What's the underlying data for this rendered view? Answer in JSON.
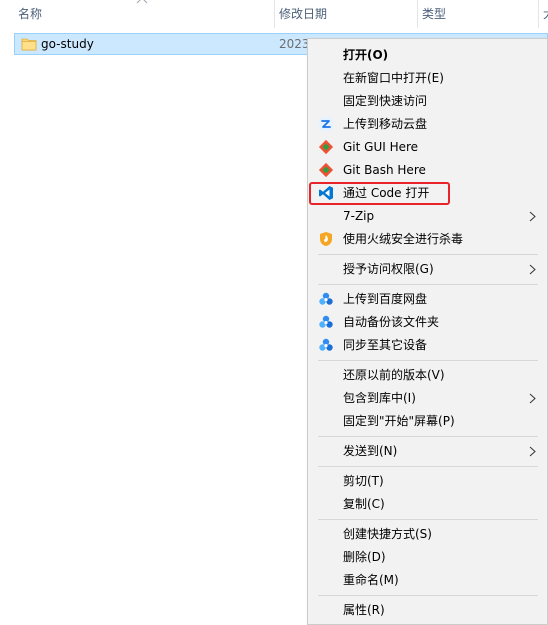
{
  "header": {
    "name": "名称",
    "date": "修改日期",
    "type": "类型",
    "size": "大"
  },
  "file": {
    "name": "go-study",
    "date": "2023"
  },
  "menu": {
    "open": "打开(O)",
    "open_new_window": "在新窗口中打开(E)",
    "pin_quick_access": "固定到快速访问",
    "upload_mobile_cloud": "上传到移动云盘",
    "git_gui": "Git GUI Here",
    "git_bash": "Git Bash Here",
    "open_with_code": "通过 Code 打开",
    "seven_zip": "7-Zip",
    "huorong_scan": "使用火绒安全进行杀毒",
    "grant_access": "授予访问权限(G)",
    "upload_baidu": "上传到百度网盘",
    "auto_backup": "自动备份该文件夹",
    "sync_devices": "同步至其它设备",
    "restore_versions": "还原以前的版本(V)",
    "include_library": "包含到库中(I)",
    "pin_start": "固定到\"开始\"屏幕(P)",
    "send_to": "发送到(N)",
    "cut": "剪切(T)",
    "copy": "复制(C)",
    "create_shortcut": "创建快捷方式(S)",
    "delete": "删除(D)",
    "rename": "重命名(M)",
    "properties": "属性(R)"
  },
  "colors": {
    "selection_bg": "#cce8ff",
    "menu_bg": "#f2f2f2",
    "highlight_border": "#e8232a",
    "vscode_blue": "#0078d4",
    "baidu_blue": "#2f8cf0"
  }
}
